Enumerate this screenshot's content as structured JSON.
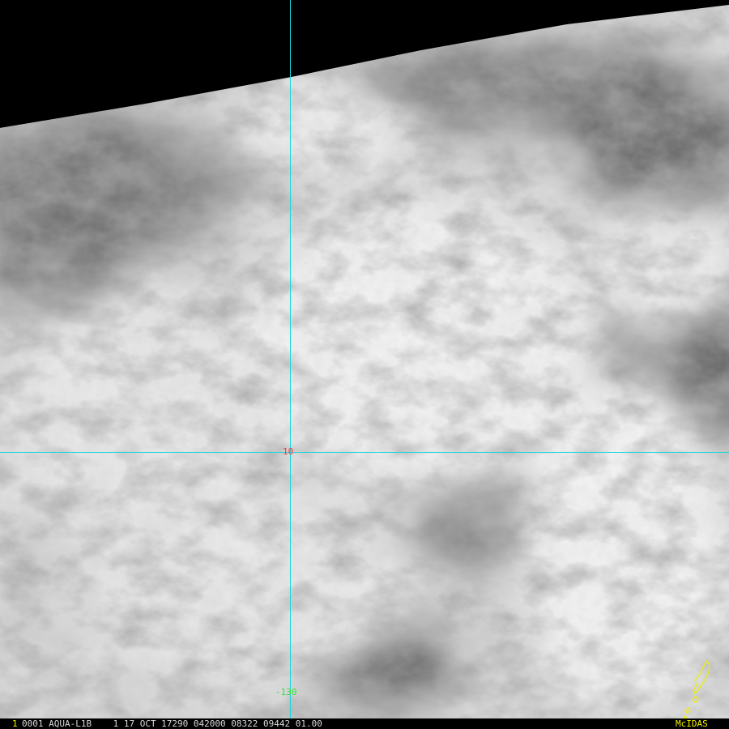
{
  "image": {
    "graticule": {
      "latitude_label": "10",
      "longitude_label": "-130",
      "line_color": "#19d6dc",
      "latitude_label_color": "#ff3030",
      "longitude_label_color": "#34e034"
    },
    "coastline_color": "#f0f000"
  },
  "status_bar": {
    "frame_number": "1",
    "frame_number_color": "#f0f000",
    "text": "0001 AQUA-L1B    1 17 OCT 17290 042000 08322 09442 01.00",
    "brand": "McIDAS",
    "brand_color": "#f0f000"
  }
}
